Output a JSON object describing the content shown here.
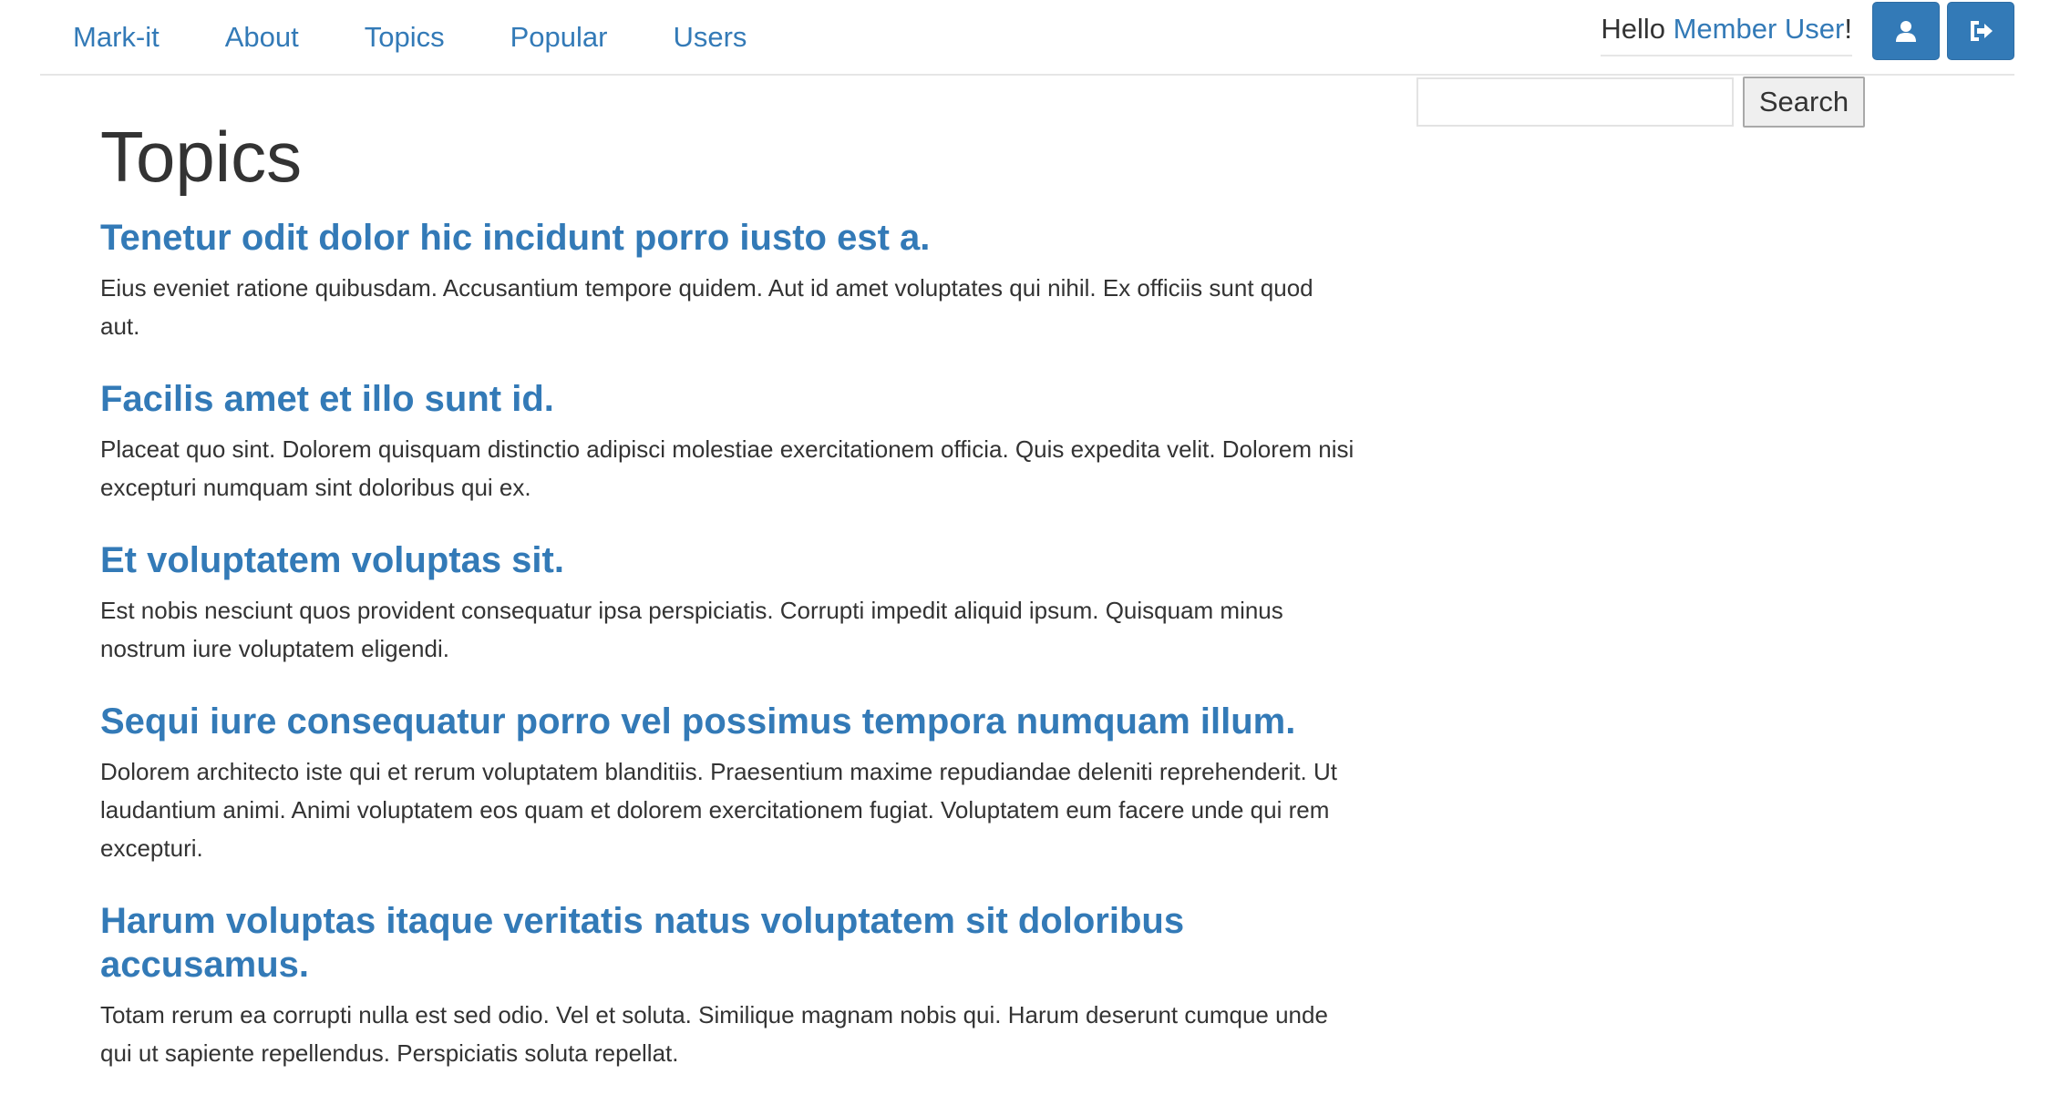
{
  "nav": {
    "brand": "Mark-it",
    "links": [
      "About",
      "Topics",
      "Popular",
      "Users"
    ]
  },
  "user": {
    "greeting_prefix": "Hello ",
    "name": "Member User",
    "greeting_suffix": "!",
    "profile_icon": "user-icon",
    "logout_icon": "sign-out-icon"
  },
  "search": {
    "placeholder": "",
    "value": "",
    "button_label": "Search"
  },
  "page": {
    "title": "Topics"
  },
  "topics": [
    {
      "title": "Tenetur odit dolor hic incidunt porro iusto est a.",
      "body": "Eius eveniet ratione quibusdam. Accusantium tempore quidem. Aut id amet voluptates qui nihil. Ex officiis sunt quod aut."
    },
    {
      "title": "Facilis amet et illo sunt id.",
      "body": "Placeat quo sint. Dolorem quisquam distinctio adipisci molestiae exercitationem officia. Quis expedita velit. Dolorem nisi excepturi numquam sint doloribus qui ex."
    },
    {
      "title": "Et voluptatem voluptas sit.",
      "body": "Est nobis nesciunt quos provident consequatur ipsa perspiciatis. Corrupti impedit aliquid ipsum. Quisquam minus nostrum iure voluptatem eligendi."
    },
    {
      "title": "Sequi iure consequatur porro vel possimus tempora numquam illum.",
      "body": "Dolorem architecto iste qui et rerum voluptatem blanditiis. Praesentium maxime repudiandae deleniti reprehenderit. Ut laudantium animi. Animi voluptatem eos quam et dolorem exercitationem fugiat. Voluptatem eum facere unde qui rem excepturi."
    },
    {
      "title": "Harum voluptas itaque veritatis natus voluptatem sit doloribus accusamus.",
      "body": "Totam rerum ea corrupti nulla est sed odio. Vel et soluta. Similique magnam nobis qui. Harum deserunt cumque unde qui ut sapiente repellendus. Perspiciatis soluta repellat."
    }
  ],
  "colors": {
    "link": "#337ab7",
    "text": "#333333",
    "button_primary": "#337ab7"
  }
}
